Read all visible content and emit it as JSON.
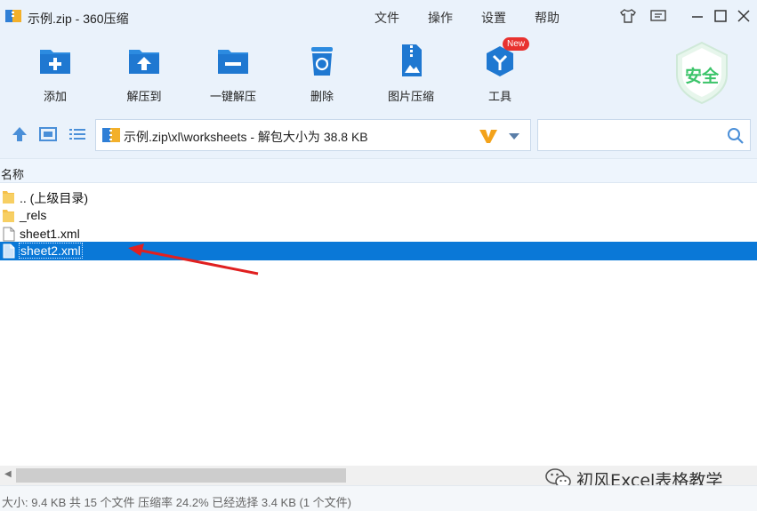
{
  "window": {
    "title": "示例.zip - 360压缩"
  },
  "menu": {
    "file": "文件",
    "operation": "操作",
    "settings": "设置",
    "help": "帮助"
  },
  "toolbar": {
    "add": "添加",
    "extract_to": "解压到",
    "one_click_extract": "一键解压",
    "delete": "删除",
    "image_compress": "图片压缩",
    "tools": "工具",
    "tools_badge": "New",
    "security_badge": "安全"
  },
  "path": {
    "text": "示例.zip\\xl\\worksheets - 解包大小为 38.8 KB"
  },
  "columns": {
    "name": "名称"
  },
  "files": [
    {
      "name": ".. (上级目录)",
      "type": "folder",
      "selected": false
    },
    {
      "name": "_rels",
      "type": "folder",
      "selected": false
    },
    {
      "name": "sheet1.xml",
      "type": "file",
      "selected": false
    },
    {
      "name": "sheet2.xml",
      "type": "file",
      "selected": true
    }
  ],
  "status": {
    "text": "大小: 9.4 KB 共 15 个文件 压缩率 24.2% 已经选择 3.4 KB (1 个文件)"
  },
  "watermark": {
    "text": "初风Excel表格教学"
  },
  "colors": {
    "accent": "#0a78d7",
    "toolbar_bg": "#eaf2fb",
    "arrow": "#e02020",
    "security": "#3cc46a"
  }
}
